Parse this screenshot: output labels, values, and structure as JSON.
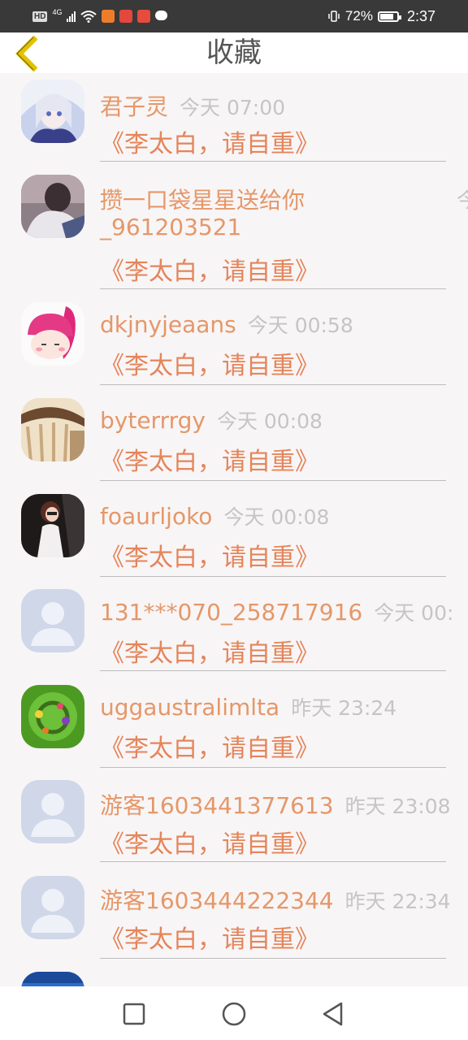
{
  "status_bar": {
    "hd": "HD",
    "network": "4G",
    "battery_percent": "72%",
    "time": "2:37",
    "battery_level": 0.72,
    "notification_icons": [
      "video-app-icon",
      "heart-app-icon",
      "book-app-icon",
      "chat-icon"
    ],
    "notification_colors": [
      "#ee7d2b",
      "#e2483d",
      "#e64b3c"
    ]
  },
  "header": {
    "title": "收藏",
    "back_icon": "chevron-left-icon",
    "back_color": "#e2c200"
  },
  "items": [
    {
      "name": "君子灵",
      "time": "今天 07:00",
      "book": "《李太白，请自重》",
      "avatar": "anime-girl-avatar"
    },
    {
      "name": "攒一口袋星星送给你",
      "name2": "_961203521",
      "time": "今",
      "book": "《李太白，请自重》",
      "avatar": "photo-avatar"
    },
    {
      "name": "dkjnyjeaans",
      "time": "今天 00:58",
      "book": "《李太白，请自重》",
      "avatar": "cartoon-girl-avatar"
    },
    {
      "name": "byterrrgy",
      "time": "今天 00:08",
      "book": "《李太白，请自重》",
      "avatar": "curtain-photo-avatar"
    },
    {
      "name": "foaurljoko",
      "time": "今天 00:08",
      "book": "《李太白，请自重》",
      "avatar": "girl-photo-avatar"
    },
    {
      "name": "131***070_258717916",
      "time": "今天 00:",
      "book": "《李太白，请自重》",
      "avatar": "default-avatar"
    },
    {
      "name": "uggaustralimlta",
      "time": "昨天 23:24",
      "book": "《李太白，请自重》",
      "avatar": "flower-wreath-avatar"
    },
    {
      "name": "游客1603441377613",
      "time": "昨天 23:08",
      "book": "《李太白，请自重》",
      "avatar": "default-avatar"
    },
    {
      "name": "游客1603444222344",
      "time": "昨天 22:34",
      "book": "《李太白，请自重》",
      "avatar": "default-avatar"
    },
    {
      "name": "",
      "time": "",
      "book": "",
      "avatar": "blue-avatar"
    }
  ],
  "nav_bar": {
    "recents_icon": "square-icon",
    "home_icon": "circle-icon",
    "back_icon": "triangle-back-icon"
  }
}
